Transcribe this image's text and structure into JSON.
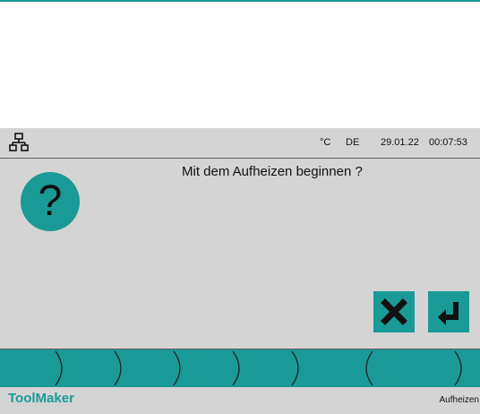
{
  "status_bar": {
    "network_icon": "network-icon",
    "unit": "°C",
    "language": "DE",
    "date": "29.01.22",
    "time": "00:07:53"
  },
  "dialog": {
    "icon": "question-mark-icon",
    "icon_glyph": "?",
    "message": "Mit dem Aufheizen beginnen ?",
    "cancel_icon": "close-icon",
    "confirm_icon": "enter-icon"
  },
  "tab_bar": {
    "tab_count": 7
  },
  "footer": {
    "brand": "ToolMaker",
    "screen_name": "Aufheizen"
  },
  "colors": {
    "accent": "#1a9a96",
    "panel": "#d4d4d4",
    "text": "#111111"
  }
}
